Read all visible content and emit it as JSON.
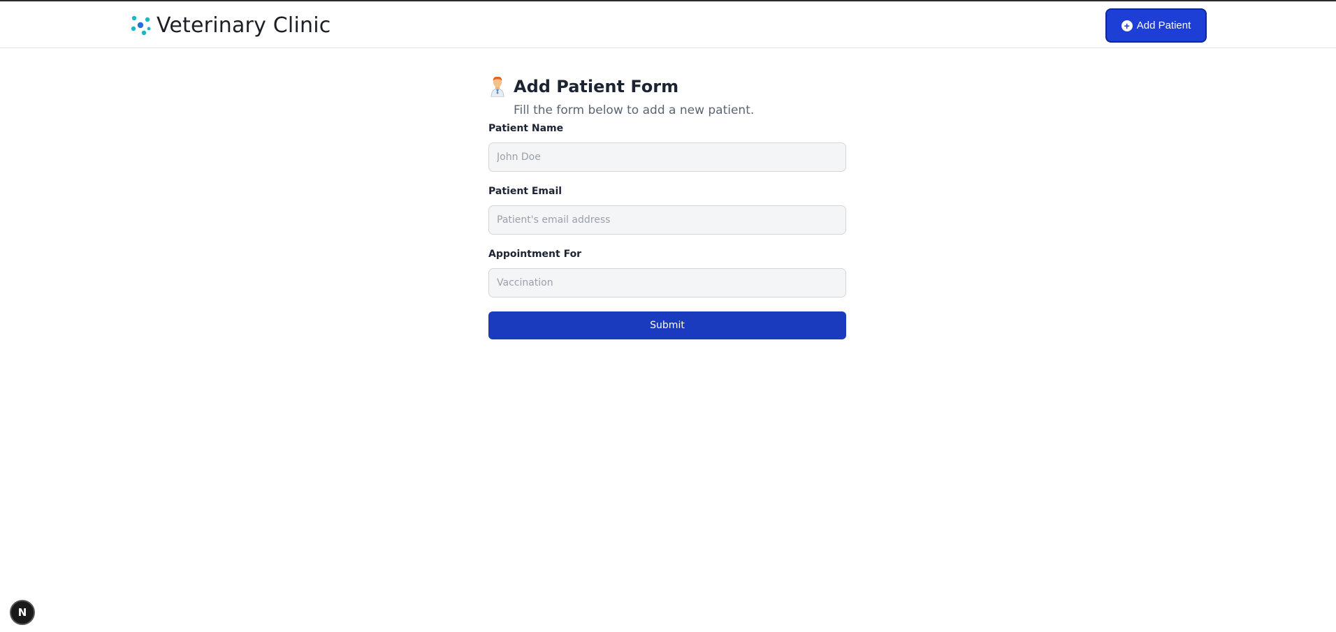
{
  "header": {
    "brand_title": "Veterinary Clinic",
    "brand_icon": "molecule-dots-icon",
    "add_patient_label": "Add Patient",
    "add_patient_icon": "plus-circle-icon"
  },
  "form": {
    "icon": "doctor-emoji-icon",
    "title": "Add Patient Form",
    "subtitle": "Fill the form below to add a new patient.",
    "fields": [
      {
        "label": "Patient Name",
        "value": "",
        "placeholder": "John Doe"
      },
      {
        "label": "Patient Email",
        "value": "",
        "placeholder": "Patient's email address"
      },
      {
        "label": "Appointment For",
        "value": "",
        "placeholder": "Vaccination"
      }
    ],
    "submit_label": "Submit"
  },
  "dev_badge": {
    "label": "N"
  },
  "colors": {
    "accent": "#1d3fd6",
    "submit": "#1b3bbf",
    "teal": "#17b8c8"
  }
}
